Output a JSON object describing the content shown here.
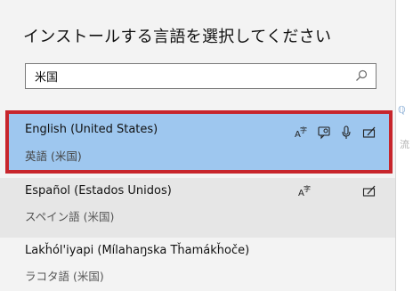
{
  "dialog": {
    "title": "インストールする言語を選択してください"
  },
  "search": {
    "value": "米国",
    "icon": "search-icon"
  },
  "languages": [
    {
      "name": "English (United States)",
      "native": "英語 (米国)",
      "selected": true,
      "features": [
        "language-pack-icon",
        "text-to-speech-icon",
        "speech-recognition-icon",
        "handwriting-icon"
      ]
    },
    {
      "name": "Español (Estados Unidos)",
      "native": "スペイン語 (米国)",
      "selected": false,
      "features": [
        "language-pack-icon",
        "handwriting-icon"
      ]
    },
    {
      "name": "Lakȟól'iyapi (Míl​ahaŋska Tȟamákȟoče)",
      "native": "ラコタ語 (米国)",
      "selected": false,
      "features": []
    }
  ],
  "colors": {
    "selected_bg": "#9ec7ef",
    "selected_border": "#c7252c",
    "dialog_bg": "#f3f3f3"
  },
  "background_fragments": [
    "ℚ",
    "流"
  ]
}
